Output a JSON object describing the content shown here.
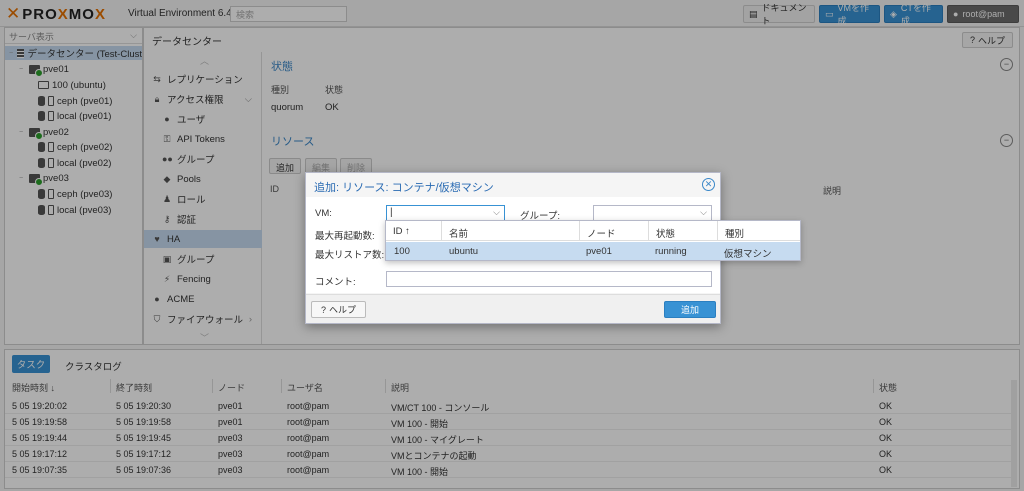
{
  "topbar": {
    "logo_text": "PROXMOX",
    "version": "Virtual Environment 6.4-5",
    "search_placeholder": "検索",
    "doc_label": "ドキュメント",
    "create_vm_label": "VMを作成",
    "create_ct_label": "CTを作成",
    "user_label": "root@pam"
  },
  "tree": {
    "view_label": "サーバ表示",
    "nodes": [
      {
        "label": "データセンター (Test-Clust",
        "icon": "datacenter-icon"
      },
      {
        "label": "pve01",
        "icon": "server-icon"
      },
      {
        "label": "100 (ubuntu)",
        "icon": "vm-icon"
      },
      {
        "label": "ceph (pve01)",
        "icon": "storage-icon"
      },
      {
        "label": "local (pve01)",
        "icon": "storage-icon"
      },
      {
        "label": "pve02",
        "icon": "server-icon"
      },
      {
        "label": "ceph (pve02)",
        "icon": "storage-icon"
      },
      {
        "label": "local (pve02)",
        "icon": "storage-icon"
      },
      {
        "label": "pve03",
        "icon": "server-icon"
      },
      {
        "label": "ceph (pve03)",
        "icon": "storage-icon"
      },
      {
        "label": "local (pve03)",
        "icon": "storage-icon"
      }
    ]
  },
  "content": {
    "title": "データセンター",
    "help_label": "ヘルプ",
    "menu": [
      {
        "label": "レプリケーション",
        "icon": "replication-icon"
      },
      {
        "label": "アクセス権限",
        "icon": "lock-icon"
      },
      {
        "label": "ユーザ",
        "icon": "user-icon"
      },
      {
        "label": "API Tokens",
        "icon": "key-icon"
      },
      {
        "label": "グループ",
        "icon": "group-icon"
      },
      {
        "label": "Pools",
        "icon": "tag-icon"
      },
      {
        "label": "ロール",
        "icon": "role-icon"
      },
      {
        "label": "認証",
        "icon": "auth-key-icon"
      },
      {
        "label": "HA",
        "icon": "heartbeat-icon"
      },
      {
        "label": "グループ",
        "icon": "ha-group-icon"
      },
      {
        "label": "Fencing",
        "icon": "fence-icon"
      },
      {
        "label": "ACME",
        "icon": "acme-icon"
      },
      {
        "label": "ファイアウォール",
        "icon": "shield-icon"
      }
    ],
    "status_panel": {
      "title": "状態",
      "col_type": "種別",
      "col_state": "状態",
      "row_type": "quorum",
      "row_state": "OK"
    },
    "resources_panel": {
      "title": "リソース",
      "btn_add": "追加",
      "btn_edit": "編集",
      "btn_remove": "削除",
      "col_id": "ID",
      "col_desc": "説明"
    }
  },
  "dialog": {
    "title": "追加: リソース: コンテナ/仮想マシン",
    "vm_label": "VM:",
    "vm_value": "",
    "group_label": "グループ:",
    "max_restart_label": "最大再起動数:",
    "max_relocate_label": "最大リストア数:",
    "comment_label": "コメント:",
    "help_label": "ヘルプ",
    "add_label": "追加"
  },
  "picker": {
    "columns": [
      "ID ↑",
      "名前",
      "ノード",
      "状態",
      "種別"
    ],
    "rows": [
      {
        "id": "100",
        "name": "ubuntu",
        "node": "pve01",
        "status": "running",
        "type": "仮想マシン"
      }
    ]
  },
  "bottom": {
    "tab_tasks": "タスク",
    "tab_cluster_log": "クラスタログ",
    "columns": [
      "開始時刻 ↓",
      "終了時刻",
      "ノード",
      "ユーザ名",
      "説明",
      "状態"
    ],
    "rows": [
      {
        "start": "5 05 19:20:02",
        "end": "5 05 19:20:30",
        "node": "pve01",
        "user": "root@pam",
        "desc": "VM/CT 100 - コンソール",
        "status": "OK"
      },
      {
        "start": "5 05 19:19:58",
        "end": "5 05 19:19:58",
        "node": "pve01",
        "user": "root@pam",
        "desc": "VM 100 - 開始",
        "status": "OK"
      },
      {
        "start": "5 05 19:19:44",
        "end": "5 05 19:19:45",
        "node": "pve03",
        "user": "root@pam",
        "desc": "VM 100 - マイグレート",
        "status": "OK"
      },
      {
        "start": "5 05 19:17:12",
        "end": "5 05 19:17:12",
        "node": "pve03",
        "user": "root@pam",
        "desc": "VMとコンテナの起動",
        "status": "OK"
      },
      {
        "start": "5 05 19:07:35",
        "end": "5 05 19:07:36",
        "node": "pve03",
        "user": "root@pam",
        "desc": "VM 100 - 開始",
        "status": "OK"
      }
    ]
  }
}
